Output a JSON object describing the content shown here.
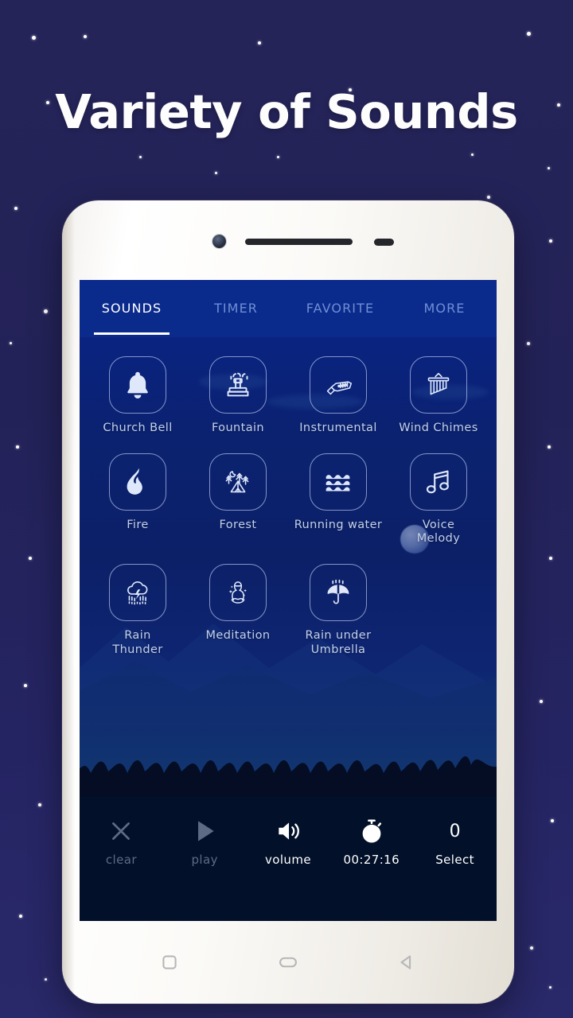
{
  "page": {
    "headline": "Variety of Sounds",
    "background_color": "#242358",
    "accent_color": "#0a2a8c"
  },
  "phone": {
    "hardware": {
      "camera": "camera-lens",
      "speaker": "earpiece-speaker",
      "sensor": "proximity-sensor"
    },
    "navbar": {
      "recents_label": "recents",
      "home_label": "home",
      "back_label": "back"
    }
  },
  "app": {
    "tabs": [
      {
        "label": "SOUNDS",
        "active": true
      },
      {
        "label": "TIMER",
        "active": false
      },
      {
        "label": "FAVORITE",
        "active": false
      },
      {
        "label": "MORE",
        "active": false
      }
    ],
    "sounds": [
      {
        "label": "Church Bell",
        "icon": "bell-icon"
      },
      {
        "label": "Fountain",
        "icon": "fountain-icon"
      },
      {
        "label": "Instrumental",
        "icon": "guitar-icon"
      },
      {
        "label": "Wind Chimes",
        "icon": "wind-chimes-icon"
      },
      {
        "label": "Fire",
        "icon": "flame-icon"
      },
      {
        "label": "Forest",
        "icon": "forest-tent-icon"
      },
      {
        "label": "Running water",
        "icon": "waves-icon"
      },
      {
        "label": "Voice\nMelody",
        "icon": "music-note-icon"
      },
      {
        "label": "Rain\nThunder",
        "icon": "thunderstorm-icon"
      },
      {
        "label": "Meditation",
        "icon": "meditation-icon"
      },
      {
        "label": "Rain under\nUmbrella",
        "icon": "umbrella-icon"
      }
    ],
    "toolbar": {
      "clear_label": "clear",
      "play_label": "play",
      "volume_label": "volume",
      "timer_value": "00:27:16",
      "select_count": "0",
      "select_label": "Select"
    }
  }
}
